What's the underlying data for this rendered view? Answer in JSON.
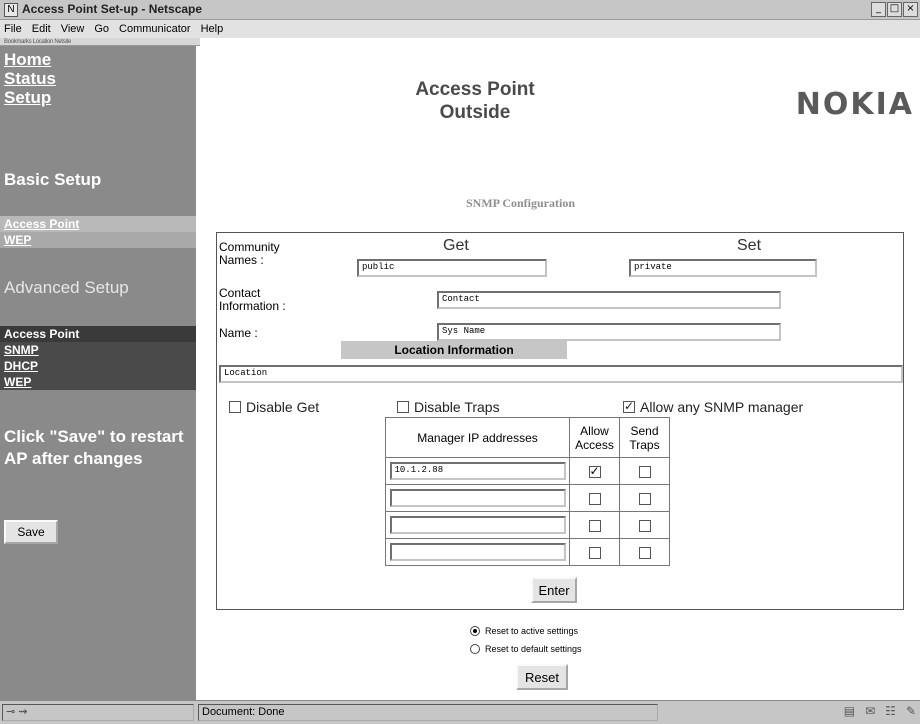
{
  "window": {
    "title": "Access Point Set-up - Netscape",
    "icon": "netscape-icon",
    "controls": [
      "_",
      "□",
      "×"
    ]
  },
  "menu": [
    "File",
    "Edit",
    "View",
    "Go",
    "Communicator",
    "Help"
  ],
  "tabstrip": "Bookmarks  Location  Netsite",
  "nav": {
    "top_links": [
      "Home",
      "Status",
      "Setup"
    ],
    "basic_heading": "Basic Setup",
    "basic_items": [
      "Access Point",
      "WEP"
    ],
    "advanced_heading": "Advanced Setup",
    "advanced_items": [
      "Access Point",
      "SNMP",
      "DHCP",
      "WEP"
    ],
    "save_message": "Click \"Save\" to restart AP after changes",
    "save_button": "Save"
  },
  "header": {
    "title_line1": "Access Point",
    "title_line2": "Outside",
    "brand": "NOKIA"
  },
  "section_title": "SNMP Configuration",
  "form": {
    "community_label": "Community Names :",
    "get_heading": "Get",
    "set_heading": "Set",
    "get_value": "public",
    "set_value": "private",
    "contact_label": "Contact Information :",
    "contact_value": "Contact",
    "name_label": "Name :",
    "name_value": "Sys Name",
    "location_heading": "Location Information",
    "location_value": "Location",
    "disable_get": "Disable Get",
    "disable_get_checked": false,
    "disable_traps": "Disable Traps",
    "disable_traps_checked": false,
    "allow_any": "Allow any SNMP manager",
    "allow_any_checked": true
  },
  "manager_table": {
    "headers": [
      "Manager IP addresses",
      "Allow Access",
      "Send Traps"
    ],
    "rows": [
      {
        "ip": "10.1.2.88",
        "allow": true,
        "send": false
      },
      {
        "ip": "",
        "allow": false,
        "send": false
      },
      {
        "ip": "",
        "allow": false,
        "send": false
      },
      {
        "ip": "",
        "allow": false,
        "send": false
      }
    ]
  },
  "enter_button": "Enter",
  "reset_options": {
    "active": "Reset to active settings",
    "default": "Reset to default settings",
    "selected": "active"
  },
  "reset_button": "Reset",
  "status": {
    "text": "Document: Done"
  }
}
